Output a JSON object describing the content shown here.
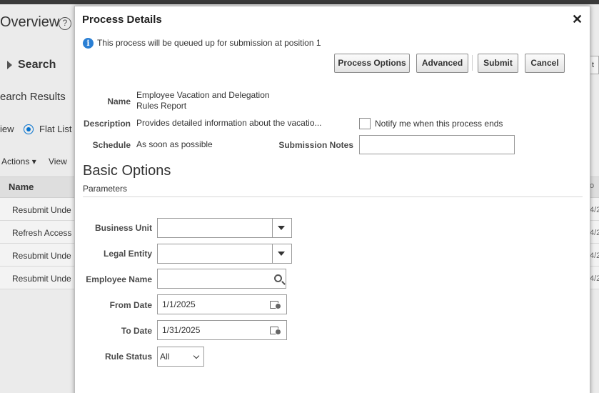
{
  "background": {
    "title": "Overview",
    "search_label": "Search",
    "results_label": "earch Results",
    "view_label": "iew",
    "flat_list_label": "Flat List",
    "actions_label": "Actions",
    "view_menu_label": "View",
    "name_header": "Name",
    "rows": [
      "Resubmit Unde",
      "Refresh Access",
      "Resubmit Unde",
      "Resubmit Unde"
    ],
    "right_header": "o",
    "right_cells": [
      "4/2",
      "4/2",
      "4/2",
      "4/2"
    ],
    "right_button": "t"
  },
  "dialog": {
    "title": "Process Details",
    "info_text": "This process will be queued up for submission at position 1",
    "buttons": {
      "process_options": "Process Options",
      "advanced": "Advanced",
      "submit": "Submit",
      "cancel": "Cancel"
    },
    "name_label": "Name",
    "name_line1": "Employee Vacation and Delegation",
    "name_line2": "Rules Report",
    "description_label": "Description",
    "description_value": "Provides detailed information about the vacatio...",
    "notify_label": "Notify me when this process ends",
    "schedule_label": "Schedule",
    "schedule_value": "As soon as possible",
    "submission_notes_label": "Submission Notes",
    "submission_notes_value": ""
  },
  "basic_options": {
    "title": "Basic Options",
    "subtitle": "Parameters",
    "business_unit_label": "Business Unit",
    "business_unit_value": "",
    "legal_entity_label": "Legal Entity",
    "legal_entity_value": "",
    "employee_name_label": "Employee Name",
    "employee_name_value": "",
    "from_date_label": "From Date",
    "from_date_value": "1/1/2025",
    "to_date_label": "To Date",
    "to_date_value": "1/31/2025",
    "rule_status_label": "Rule Status",
    "rule_status_value": "All"
  }
}
